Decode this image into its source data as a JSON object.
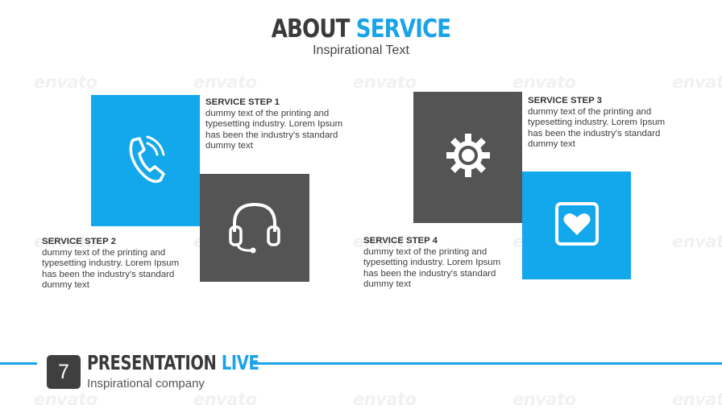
{
  "header": {
    "title_part1": "ABOUT",
    "title_part2": "SERVICE",
    "subtitle": "Inspirational Text"
  },
  "steps": [
    {
      "title": "SERVICE STEP 1",
      "body": "dummy text of the printing and typesetting industry. Lorem Ipsum has been the industry's standard dummy text"
    },
    {
      "title": "SERVICE STEP 2",
      "body": "dummy text of the printing and typesetting industry. Lorem Ipsum has been the industry's standard dummy text"
    },
    {
      "title": "SERVICE STEP 3",
      "body": "dummy text of the printing and typesetting industry. Lorem Ipsum has been the industry's standard dummy text"
    },
    {
      "title": "SERVICE STEP 4",
      "body": "dummy text of the printing and typesetting industry. Lorem Ipsum has been the industry's standard dummy text"
    }
  ],
  "icons": {
    "step1": "phone-icon",
    "step2": "headset-icon",
    "step3": "gear-icon",
    "step4": "heart-icon"
  },
  "footer": {
    "slide_number": "7",
    "brand_part1": "PRESENTATION",
    "brand_part2": "LIVE",
    "company": "Inspirational company"
  },
  "watermark": "envato",
  "colors": {
    "accent": "#13a7ec",
    "dark": "#545454",
    "text": "#3e3e3e"
  }
}
